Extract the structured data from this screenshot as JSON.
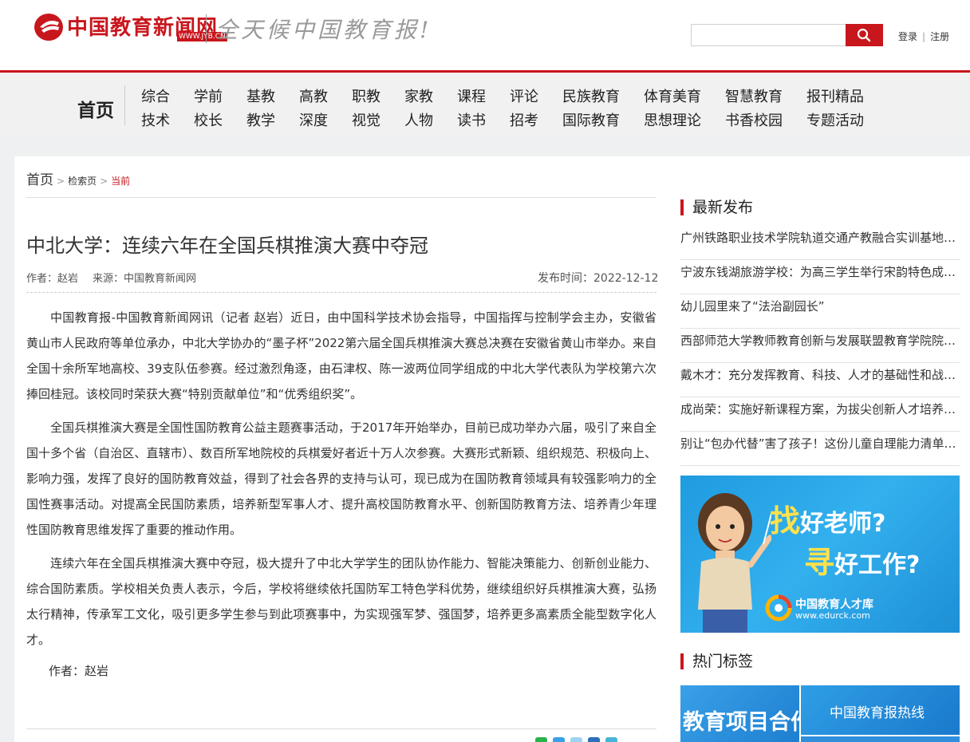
{
  "header": {
    "logo_text": "中国教育新闻网",
    "logo_url": "WWW.JYB.CN",
    "slogan": "全天候中国教育报!",
    "search_placeholder": "",
    "login": "登录",
    "separator": "|",
    "register": "注册"
  },
  "nav": {
    "home": "首页",
    "row1": [
      "综合",
      "学前",
      "基教",
      "高教",
      "职教",
      "家教",
      "课程",
      "评论",
      "民族教育",
      "体育美育",
      "智慧教育",
      "报刊精品"
    ],
    "row2": [
      "技术",
      "校长",
      "教学",
      "深度",
      "视觉",
      "人物",
      "读书",
      "招考",
      "国际教育",
      "思想理论",
      "书香校园",
      "专题活动"
    ]
  },
  "breadcrumb": {
    "home": "首页",
    "middle": "检索页",
    "current": "当前",
    "arrow": ">"
  },
  "article": {
    "title": "中北大学：连续六年在全国兵棋推演大赛中夺冠",
    "author": "作者：赵岩",
    "source": "来源：中国教育新闻网",
    "pubtime": "发布时间：2022-12-12",
    "paragraphs": [
      "中国教育报-中国教育新闻网讯（记者 赵岩）近日，由中国科学技术协会指导，中国指挥与控制学会主办，安徽省黄山市人民政府等单位承办，中北大学协办的“墨子杯”2022第六届全国兵棋推演大赛总决赛在安徽省黄山市举办。来自全国十余所军地高校、39支队伍参赛。经过激烈角逐，由石津权、陈一波两位同学组成的中北大学代表队为学校第六次捧回桂冠。该校同时荣获大赛“特别贡献单位”和“优秀组织奖”。",
      "全国兵棋推演大赛是全国性国防教育公益主题赛事活动，于2017年开始举办，目前已成功举办六届，吸引了来自全国十多个省（自治区、直辖市）、数百所军地院校的兵棋爱好者近十万人次参赛。大赛形式新颖、组织规范、积极向上、影响力强，发挥了良好的国防教育效益，得到了社会各界的支持与认可，现已成为在国防教育领域具有较强影响力的全国性赛事活动。对提高全民国防素质，培养新型军事人才、提升高校国防教育水平、创新国防教育方法、培养青少年理性国防教育思维发挥了重要的推动作用。",
      "连续六年在全国兵棋推演大赛中夺冠，极大提升了中北大学学生的团队协作能力、智能决策能力、创新创业能力、综合国防素质。学校相关负责人表示，今后，学校将继续依托国防军工特色学科优势，继续组织好兵棋推演大赛，弘扬太行精神，传承军工文化，吸引更多学生参与到此项赛事中，为实现强军梦、强国梦，培养更多高素质全能型数字化人才。"
    ],
    "end_author": "作者：赵岩"
  },
  "sidebar": {
    "latest_title": "最新发布",
    "latest": [
      "广州铁路职业技术学院轨道交通产教融合实训基地建设",
      "宁波东钱湖旅游学校：为高三学生举行宋韵特色成人礼",
      "幼儿园里来了“法治副园长”",
      "西部师范大学教师教育创新与发展联盟教育学院院长论坛",
      "戴木才：充分发挥教育、科技、人才的基础性和战略性支撑作用",
      "成尚荣：实施好新课程方案，为拔尖创新人才培养奠基",
      "别让“包办代替”害了孩子！这份儿童自理能力清单请收好"
    ],
    "ad": {
      "line1_big": "找",
      "line1": "好老师?",
      "line2_big": "寻",
      "line2": "好工作?",
      "brand": "中国教育人才库",
      "brand_url": "www.edurck.com"
    },
    "hot_tags_title": "热门标签",
    "tag_a": "教育项目合作",
    "tag_b": "中国教育报热线"
  },
  "colors": {
    "brand_red": "#c8161d",
    "ad_blue": "#1f9be0"
  }
}
